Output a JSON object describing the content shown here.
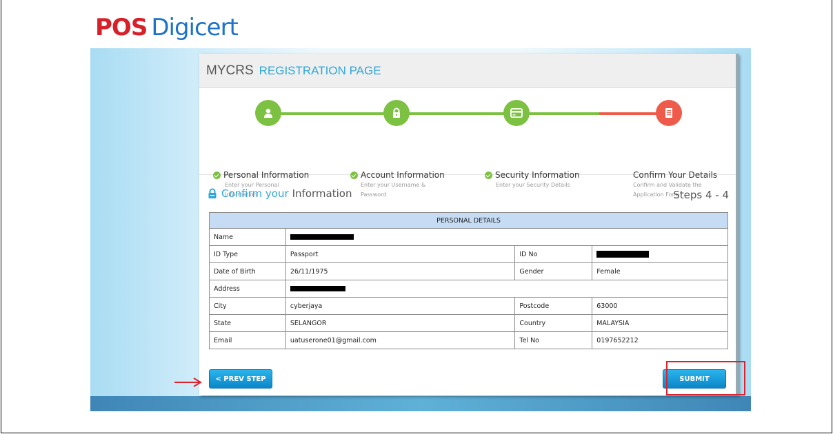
{
  "logo": {
    "part1": "POS",
    "part2": "Digicert"
  },
  "header": {
    "title": "MYCRS",
    "subtitle": "REGISTRATION PAGE"
  },
  "steps": [
    {
      "title": "Personal Information",
      "sub1": "Enter your Personal",
      "sub2": "Information",
      "icon": "user-icon",
      "color": "#7cc142"
    },
    {
      "title": "Account Information",
      "sub1": "Enter your Username &",
      "sub2": "Password",
      "icon": "lock-icon",
      "color": "#7cc142"
    },
    {
      "title": "Security Information",
      "sub1": "Enter your Security Details",
      "sub2": "",
      "icon": "card-icon",
      "color": "#7cc142"
    },
    {
      "title": "Confirm Your Details",
      "sub1": "Confirm and Validate the",
      "sub2": "Application Form",
      "icon": "document-icon",
      "color": "#ef5b4b"
    }
  ],
  "confirm": {
    "part1": "Confirm your",
    "part2": "Information",
    "steps": "Steps 4 - 4"
  },
  "table": {
    "header": "PERSONAL DETAILS",
    "rows": {
      "name_label": "Name",
      "idtype_label": "ID Type",
      "idtype_value": "Passport",
      "idno_label": "ID No",
      "dob_label": "Date of Birth",
      "dob_value": "26/11/1975",
      "gender_label": "Gender",
      "gender_value": "Female",
      "address_label": "Address",
      "city_label": "City",
      "city_value": "cyberjaya",
      "postcode_label": "Postcode",
      "postcode_value": "63000",
      "state_label": "State",
      "state_value": "SELANGOR",
      "country_label": "Country",
      "country_value": "MALAYSIA",
      "email_label": "Email",
      "email_value": "uatuserone01@gmail.com",
      "tel_label": "Tel No",
      "tel_value": "0197652212"
    }
  },
  "buttons": {
    "prev": "< PREV STEP",
    "submit": "SUBMIT"
  },
  "colors": {
    "accent": "#2fa7d6",
    "step_done": "#7cc142",
    "step_current": "#ef5b4b",
    "annotation": "#e0202a"
  }
}
